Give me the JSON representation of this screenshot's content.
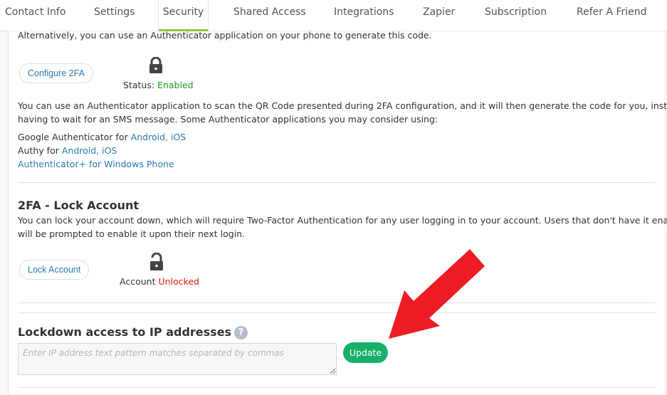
{
  "tabs": [
    {
      "label": "Contact Info",
      "active": false
    },
    {
      "label": "Settings",
      "active": false
    },
    {
      "label": "Security",
      "active": true
    },
    {
      "label": "Shared Access",
      "active": false
    },
    {
      "label": "Integrations",
      "active": false
    },
    {
      "label": "Zapier",
      "active": false
    },
    {
      "label": "Subscription",
      "active": false
    },
    {
      "label": "Refer A Friend",
      "active": false
    }
  ],
  "twofa": {
    "intro": "Alternatively, you can use an Authenticator application on your phone to generate this code.",
    "configure_button": "Configure 2FA",
    "status_label": "Status:",
    "status_value": "Enabled",
    "status_icon": "lock-closed-icon",
    "description_line1": "You can use an Authenticator application to scan the QR Code presented during 2FA configuration, and it will then generate the code for you, instead of",
    "description_line2": "having to wait for an SMS message. Some Authenticator applications you may consider using:",
    "apps": [
      {
        "prefix": "Google Authenticator for ",
        "links": [
          "Android",
          "iOS"
        ]
      },
      {
        "prefix": "Authy for ",
        "links": [
          "Android",
          "iOS"
        ]
      },
      {
        "prefix": "",
        "links": [
          "Authenticator+ for Windows Phone"
        ]
      }
    ]
  },
  "lock_account": {
    "title": "2FA - Lock Account",
    "description_line1": "You can lock your account down, which will require Two-Factor Authentication for any user logging in to your account. Users that don't have it enabled",
    "description_line2": "will be prompted to enable it upon their next login.",
    "button": "Lock Account",
    "status_label": "Account",
    "status_value": "Unlocked",
    "status_icon": "lock-open-icon"
  },
  "ip_lockdown": {
    "title": "Lockdown access to IP addresses",
    "help_glyph": "?",
    "input_value": "",
    "placeholder": "Enter IP address text pattern matches separated by commas",
    "update_button": "Update"
  },
  "colors": {
    "accent_tab": "#8cc63f",
    "link": "#2a7ab8",
    "enabled": "#1e9a1e",
    "unlocked": "#e01b1b",
    "update_button": "#17b06b",
    "annotation_arrow": "#ed1c24"
  }
}
